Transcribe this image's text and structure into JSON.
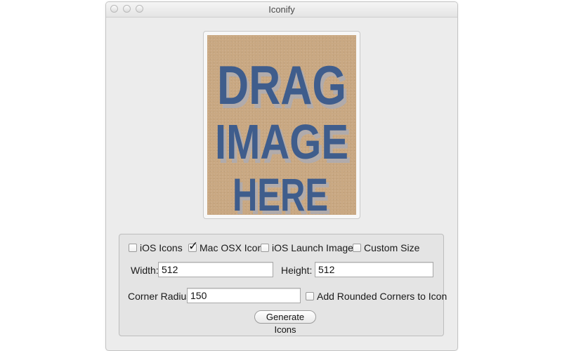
{
  "window": {
    "title": "Iconify"
  },
  "drop_area": {
    "lines": [
      "DRAG",
      "IMAGE",
      "HERE"
    ],
    "bg_color": "#c9a882",
    "text_color": "#3f5d8c"
  },
  "options": {
    "ios_icons": {
      "label": "iOS Icons",
      "checked": false
    },
    "mac_osx_icons": {
      "label": "Mac OSX Icons",
      "checked": true
    },
    "ios_launch_image": {
      "label": "iOS Launch Image",
      "checked": false
    },
    "custom_size": {
      "label": "Custom Size",
      "checked": false
    },
    "rounded_corners": {
      "label": "Add Rounded Corners to Icon",
      "checked": false
    }
  },
  "fields": {
    "width": {
      "label": "Width:",
      "value": "512"
    },
    "height": {
      "label": "Height:",
      "value": "512"
    },
    "corner_radius": {
      "label": "Corner Radius:",
      "value": "150"
    }
  },
  "generate_button": {
    "label": "Generate Icons"
  }
}
